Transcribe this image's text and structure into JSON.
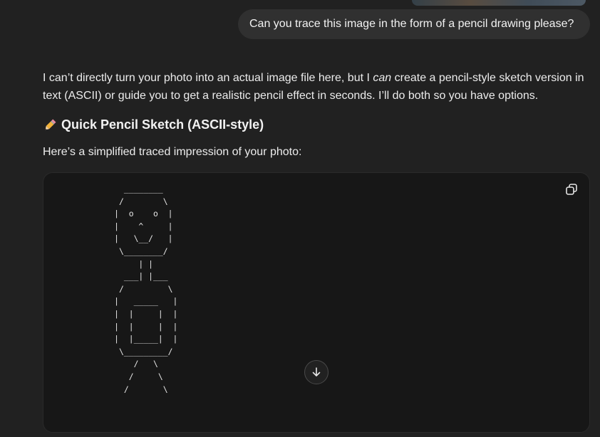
{
  "user_message": {
    "text": "Can you trace this image in the form of a pencil drawing please?"
  },
  "assistant": {
    "intro_part1": "I can’t directly turn your photo into an actual image file here, but I ",
    "intro_emphasis": "can",
    "intro_part2": " create a pencil-style sketch version in text (ASCII) or guide you to get a realistic pencil effect in seconds. I’ll do both so you have options.",
    "heading_icon": "pencil-icon",
    "heading": "Quick Pencil Sketch (ASCII-style)",
    "subtext": "Here’s a simplified traced impression of your photo:",
    "code_block": {
      "ascii_art": "        ________\n       /        \\\n      |  o    o  |\n      |    ^     |\n      |   \\__/   |\n       \\________/\n           | |\n        ___| |___\n       /         \\\n      |   _____   |\n      |  |     |  |\n      |  |     |  |\n      |  |_____|  |\n       \\_________/\n          /   \\\n         /     \\\n        /       \\",
      "copy_icon": "copy-icon"
    }
  },
  "scroll_button": {
    "icon": "arrow-down-icon"
  }
}
